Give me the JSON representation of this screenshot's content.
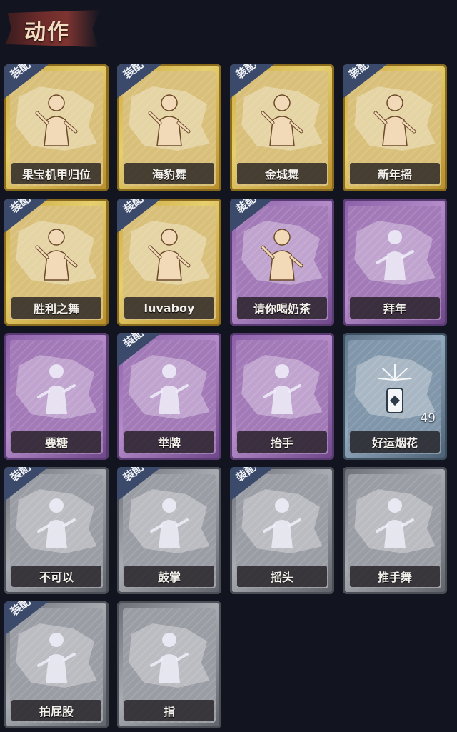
{
  "page_title": "动作",
  "equip_label": "装配",
  "actions": [
    {
      "name": "果宝机甲归位",
      "rarity": "gold",
      "equipped": true,
      "count": "",
      "icon": "dancing-figure-icon"
    },
    {
      "name": "海豹舞",
      "rarity": "gold",
      "equipped": true,
      "count": "",
      "icon": "dancing-figure-icon"
    },
    {
      "name": "金城舞",
      "rarity": "gold",
      "equipped": true,
      "count": "",
      "icon": "waving-figure-icon"
    },
    {
      "name": "新年摇",
      "rarity": "gold",
      "equipped": true,
      "count": "",
      "icon": "dancing-figure-icon"
    },
    {
      "name": "胜利之舞",
      "rarity": "gold",
      "equipped": true,
      "count": "",
      "icon": "victory-figure-icon"
    },
    {
      "name": "luvaboy",
      "rarity": "gold",
      "equipped": true,
      "count": "",
      "icon": "dancing-figure-icon"
    },
    {
      "name": "请你喝奶茶",
      "rarity": "purple",
      "equipped": true,
      "count": "",
      "icon": "figure-with-sign-icon"
    },
    {
      "name": "拜年",
      "rarity": "purple",
      "equipped": false,
      "count": "",
      "icon": "bowing-figure-icon"
    },
    {
      "name": "要糖",
      "rarity": "purple",
      "equipped": false,
      "count": "",
      "icon": "reaching-figure-icon"
    },
    {
      "name": "举牌",
      "rarity": "purple",
      "equipped": true,
      "count": "",
      "icon": "holding-sign-icon"
    },
    {
      "name": "抬手",
      "rarity": "purple",
      "equipped": false,
      "count": "",
      "icon": "raising-hand-icon"
    },
    {
      "name": "好运烟花",
      "rarity": "blue",
      "equipped": false,
      "count": "49",
      "icon": "firework-icon"
    },
    {
      "name": "不可以",
      "rarity": "silver",
      "equipped": true,
      "count": "",
      "icon": "finger-wag-icon"
    },
    {
      "name": "鼓掌",
      "rarity": "silver",
      "equipped": true,
      "count": "",
      "icon": "clapping-hands-icon"
    },
    {
      "name": "摇头",
      "rarity": "silver",
      "equipped": true,
      "count": "",
      "icon": "shaking-head-icon"
    },
    {
      "name": "推手舞",
      "rarity": "silver",
      "equipped": false,
      "count": "",
      "icon": "push-hands-icon"
    },
    {
      "name": "拍屁股",
      "rarity": "silver",
      "equipped": true,
      "count": "",
      "icon": "pat-bottom-icon"
    },
    {
      "name": "指",
      "rarity": "silver",
      "equipped": false,
      "count": "",
      "icon": "pointing-hand-icon"
    }
  ]
}
